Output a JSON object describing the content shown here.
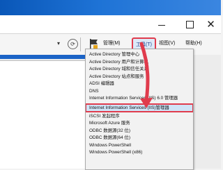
{
  "menubar": {
    "manage": "管理(M)",
    "tools": "工具(T)",
    "view": "视图(V)",
    "help": "帮助(H)"
  },
  "tools_menu": {
    "items": [
      "Active Directory 管理中心",
      "Active Directory 用户和计算机",
      "Active Directory 域和信任关系",
      "Active Directory 站点和服务",
      "ADSI 编辑器",
      "DNS",
      "Internet Information Services (IIS) 6.0 管理器",
      "Internet Information Services (IIS)管理器",
      "iSCSI 发起程序",
      "Microsoft Azure 服务",
      "ODBC 数据源(32 位)",
      "ODBC 数据源(64 位)",
      "Windows PowerShell",
      "Windows PowerShell (x86)"
    ],
    "highlighted_index": 7
  },
  "icons": {
    "refresh": "refresh-icon",
    "flag": "notifications-flag-icon",
    "minimize": "minimize-icon",
    "maximize": "maximize-icon",
    "close": "close-icon"
  },
  "colors": {
    "annotation": "#e03b4c",
    "highlight": "#cfe4f7",
    "desktop": "#1e73d6"
  }
}
